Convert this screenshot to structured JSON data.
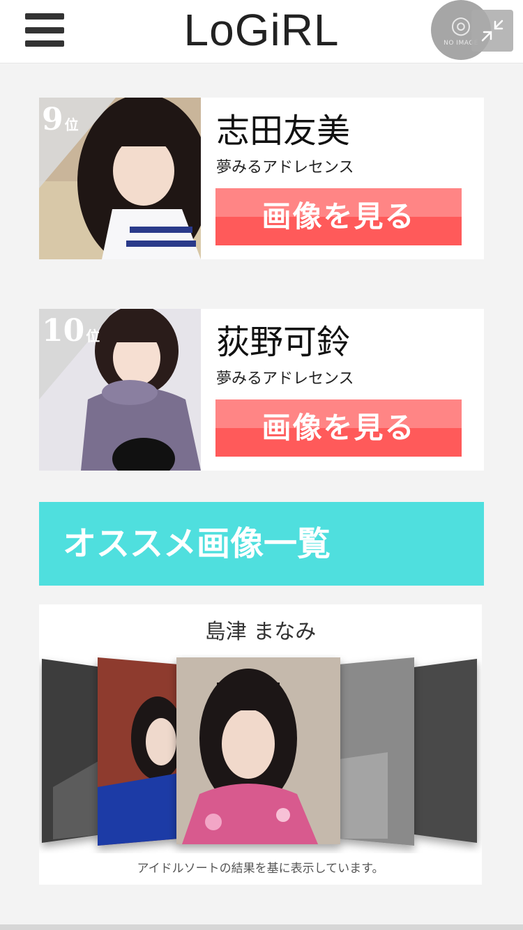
{
  "header": {
    "logo": "LoGiRL",
    "no_image": "NO IMAGE",
    "menu_icon": "hamburger-icon",
    "expand_icon": "expand-arrows-icon"
  },
  "ranking": [
    {
      "rank": "9",
      "rank_suffix": "位",
      "name": "志田友美",
      "group": "夢みるアドレセンス",
      "button_label": "画像を見る"
    },
    {
      "rank": "10",
      "rank_suffix": "位",
      "name": "荻野可鈴",
      "group": "夢みるアドレセンス",
      "button_label": "画像を見る"
    }
  ],
  "recommend": {
    "title": "オススメ画像一覧",
    "featured_name": "島津 まなみ",
    "caption": "アイドルソートの結果を基に表示しています。"
  },
  "colors": {
    "accent_button": "#ff5a5a",
    "banner": "#4fdfde"
  }
}
